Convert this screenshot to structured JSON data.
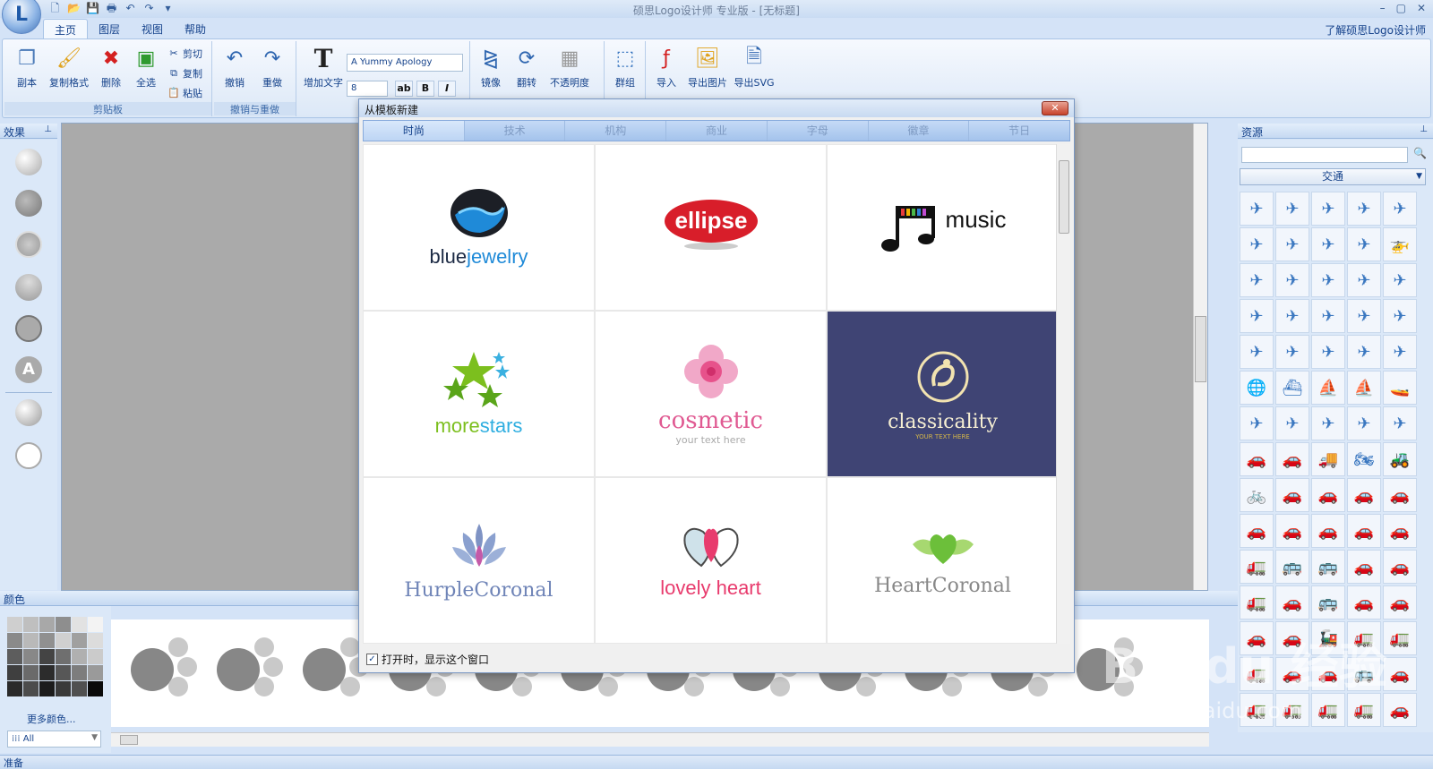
{
  "app": {
    "title": "硕思Logo设计师 专业版 - [无标题]",
    "learn_link": "了解硕思Logo设计师",
    "orb_label": "L",
    "qat": [
      "new",
      "open",
      "save",
      "print",
      "undo",
      "redo",
      "more"
    ]
  },
  "ribbon_tabs": [
    "主页",
    "图层",
    "视图",
    "帮助"
  ],
  "ribbon": {
    "clipboard": {
      "label": "剪贴板",
      "duplicate": "副本",
      "copy_format": "复制格式",
      "delete": "删除",
      "select_all": "全选",
      "cut": "剪切",
      "copy": "复制",
      "paste": "粘贴"
    },
    "undo_redo": {
      "label": "撤销与重做",
      "undo": "撤销",
      "redo": "重做"
    },
    "text": {
      "add_text": "增加文字",
      "font": "A Yummy Apology",
      "size": "8",
      "bold": "B",
      "italic": "I"
    },
    "transform": {
      "mirror": "镜像",
      "flip": "翻转",
      "opacity": "不透明度",
      "group": "群组"
    },
    "io": {
      "import": "导入",
      "export_image": "导出图片",
      "export_svg": "导出SVG"
    }
  },
  "panels": {
    "effects": "效果",
    "colors": "颜色",
    "resources": "资源",
    "more_colors": "更多颜色...",
    "all_option": "All",
    "resource_category": "交通"
  },
  "dialog": {
    "title": "从模板新建",
    "close": "✕",
    "tabs": [
      "时尚",
      "技术",
      "机构",
      "商业",
      "字母",
      "徽章",
      "节日"
    ],
    "show_on_start": "打开时，显示这个窗口",
    "templates": [
      {
        "name_a": "blue",
        "name_b": "jewelry"
      },
      {
        "name_a": "ellipse",
        "name_b": ""
      },
      {
        "name_a": "music",
        "name_b": ""
      },
      {
        "name_a": "more",
        "name_b": "stars"
      },
      {
        "name_a": "cosmetic",
        "name_b": "your text here"
      },
      {
        "name_a": "classicality",
        "name_b": "YOUR TEXT HERE"
      },
      {
        "name_a": "HurpleCoronal",
        "name_b": ""
      },
      {
        "name_a": "lovely heart",
        "name_b": ""
      },
      {
        "name_a": "HeartCoronal",
        "name_b": ""
      }
    ]
  },
  "status": "准备",
  "watermark": {
    "text": "Bai du 经验",
    "url": "jingyan.baidu.com"
  },
  "colors_palette": [
    "#cfcfcf",
    "#bfbfbf",
    "#a8a8a8",
    "#8e8e8e",
    "#e2e2e2",
    "#f3f3f3",
    "#8a8a8a",
    "#b9b9b9",
    "#909090",
    "#d0d0d0",
    "#a0a0a0",
    "#dcdcdc",
    "#5d5d5d",
    "#888888",
    "#444444",
    "#6f6f6f",
    "#b0b0b0",
    "#cbcbcb",
    "#3f3f3f",
    "#6a6a6a",
    "#2c2c2c",
    "#575757",
    "#7d7d7d",
    "#9a9a9a",
    "#2a2a2a",
    "#4c4c4c",
    "#1c1c1c",
    "#3a3a3a",
    "#505050",
    "#0a0a0a"
  ],
  "resource_icons": [
    "✈",
    "✈",
    "✈",
    "✈",
    "✈",
    "✈",
    "✈",
    "✈",
    "✈",
    "🚁",
    "✈",
    "✈",
    "✈",
    "✈",
    "✈",
    "✈",
    "✈",
    "✈",
    "✈",
    "✈",
    "✈",
    "✈",
    "✈",
    "✈",
    "✈",
    "🌐",
    "⛴",
    "⛵",
    "⛵",
    "🚤",
    "✈",
    "✈",
    "✈",
    "✈",
    "✈",
    "🚗",
    "🚗",
    "🚚",
    "🏍",
    "🚜",
    "🚲",
    "🚗",
    "🚗",
    "🚗",
    "🚗",
    "🚗",
    "🚗",
    "🚗",
    "🚗",
    "🚗",
    "🚛",
    "🚌",
    "🚌",
    "🚗",
    "🚗",
    "🚛",
    "🚗",
    "🚌",
    "🚗",
    "🚗",
    "🚗",
    "🚗",
    "🚂",
    "🚛",
    "🚛",
    "🚛",
    "🚗",
    "🚗",
    "🚌",
    "🚗",
    "🚛",
    "🚛",
    "🚛",
    "🚛",
    "🚗"
  ]
}
